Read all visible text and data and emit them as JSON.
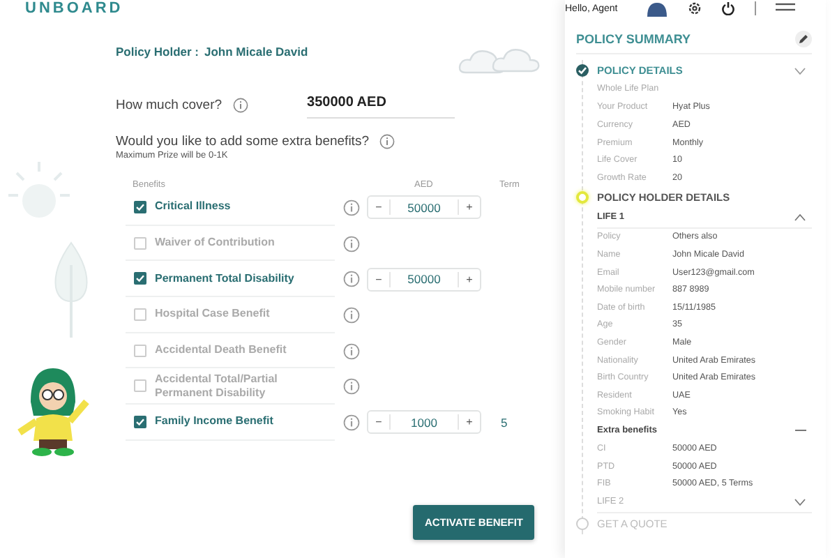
{
  "header": {
    "logo": "UNBOARD",
    "greeting": "Hello, Agent"
  },
  "policy_holder": {
    "label": "Policy Holder :",
    "name": "John Micale David"
  },
  "cover": {
    "label": "How much cover?",
    "value": "350000 AED"
  },
  "extras": {
    "question": "Would you like to add some extra benefits?",
    "note": "Maximum Prize will be 0-1K"
  },
  "table": {
    "columns": [
      "Benefits",
      "AED",
      "Term"
    ],
    "rows": [
      {
        "name": "Critical Illness",
        "checked": true,
        "minus": "−",
        "amount": "50000",
        "plus": "+"
      },
      {
        "name": "Waiver of Contribution",
        "checked": false
      },
      {
        "name": "Permanent Total Disability",
        "checked": true,
        "minus": "−",
        "amount": "50000",
        "plus": "+"
      },
      {
        "name": "Hospital Case Benefit",
        "checked": false
      },
      {
        "name": "Accidental Death Benefit",
        "checked": false
      },
      {
        "name": "Accidental Total/Partial Permanent Disability",
        "checked": false
      },
      {
        "name": "Family Income Benefit",
        "checked": true,
        "minus": "−",
        "amount": "1000",
        "plus": "+",
        "term": "5"
      }
    ]
  },
  "activate_button": "ACTIVATE BENEFIT",
  "summary": {
    "title": "POLICY SUMMARY",
    "steps": [
      {
        "title": "POLICY DETAILS",
        "completed": true,
        "active": false,
        "subtitle": "Whole Life Plan",
        "rows": [
          {
            "label": "Your Product",
            "value": "Hyat Plus"
          },
          {
            "label": "Currency",
            "value": "AED"
          },
          {
            "label": "Premium",
            "value": "Monthly"
          },
          {
            "label": "Life Cover",
            "value": "10"
          },
          {
            "label": "Growth Rate",
            "value": "20"
          }
        ]
      },
      {
        "title": "POLICY HOLDER DETAILS",
        "completed": false,
        "active": true,
        "lives": [
          {
            "title": "LIFE 1",
            "expanded": true,
            "rows": [
              {
                "label": "Policy",
                "value": "Others also"
              },
              {
                "label": "Name",
                "value": "John Micale David"
              },
              {
                "label": "Email",
                "value": "User123@gmail.com"
              },
              {
                "label": "Mobile number",
                "value": "887 8989"
              },
              {
                "label": "Date of birth",
                "value": "15/11/1985"
              },
              {
                "label": "Age",
                "value": "35"
              },
              {
                "label": "Gender",
                "value": "Male"
              },
              {
                "label": "Nationality",
                "value": "United Arab Emirates"
              },
              {
                "label": "Birth Country",
                "value": "United Arab Emirates"
              },
              {
                "label": "Resident",
                "value": "UAE"
              },
              {
                "label": "Smoking Habit",
                "value": "Yes"
              }
            ],
            "extra": {
              "title": "Extra benefits",
              "rows": [
                {
                  "label": "CI",
                  "value": "50000 AED"
                },
                {
                  "label": "PTD",
                  "value": "50000 AED"
                },
                {
                  "label": "FIB",
                  "value": "50000 AED, 5 Terms"
                }
              ]
            }
          },
          {
            "title": "LIFE 2",
            "expanded": false
          }
        ]
      },
      {
        "title": "GET A QUOTE",
        "completed": false,
        "active": false
      }
    ]
  }
}
